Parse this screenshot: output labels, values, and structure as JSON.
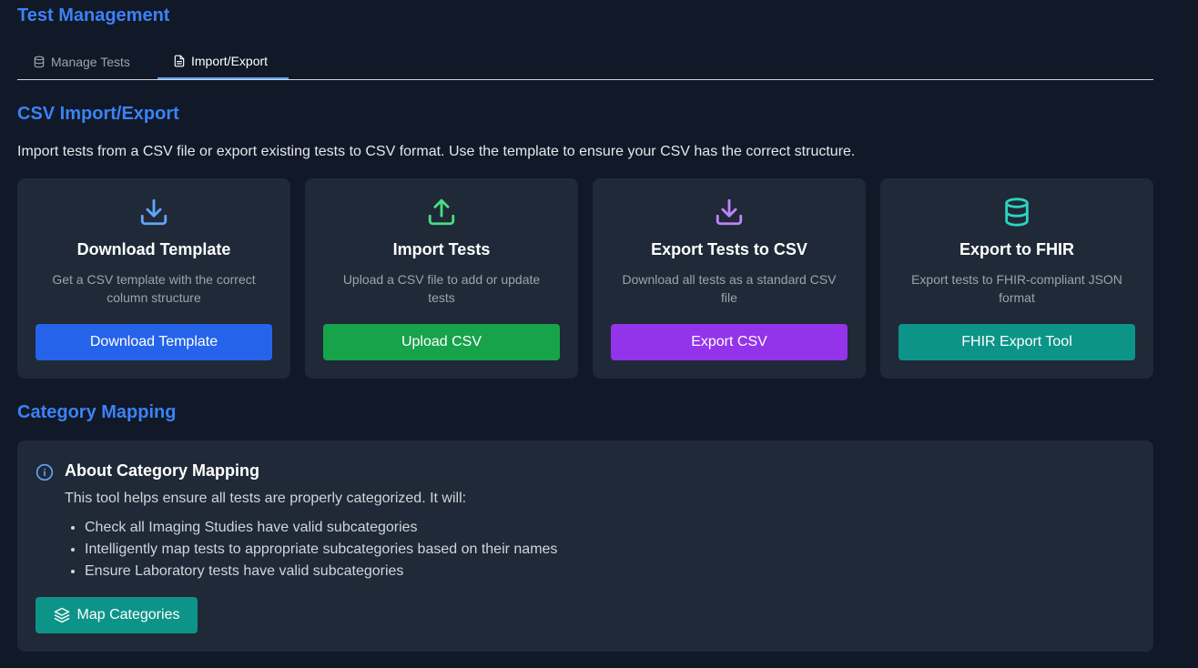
{
  "header": {
    "title": "Test Management"
  },
  "tabs": [
    {
      "label": "Manage Tests",
      "icon": "database-icon",
      "active": false
    },
    {
      "label": "Import/Export",
      "icon": "file-text-icon",
      "active": true
    }
  ],
  "csv_section": {
    "title": "CSV Import/Export",
    "intro": "Import tests from a CSV file or export existing tests to CSV format. Use the template to ensure your CSV has the correct structure.",
    "cards": [
      {
        "icon": "download-icon",
        "icon_color": "#60a5fa",
        "title": "Download Template",
        "description": "Get a CSV template with the correct column structure",
        "button_label": "Download Template",
        "button_color": "#2563eb"
      },
      {
        "icon": "upload-icon",
        "icon_color": "#4ade80",
        "title": "Import Tests",
        "description": "Upload a CSV file to add or update tests",
        "button_label": "Upload CSV",
        "button_color": "#16a34a"
      },
      {
        "icon": "download-icon",
        "icon_color": "#c084fc",
        "title": "Export Tests to CSV",
        "description": "Download all tests as a standard CSV file",
        "button_label": "Export CSV",
        "button_color": "#9333ea"
      },
      {
        "icon": "database-icon",
        "icon_color": "#2dd4bf",
        "title": "Export to FHIR",
        "description": "Export tests to FHIR-compliant JSON format",
        "button_label": "FHIR Export Tool",
        "button_color": "#0d9488"
      }
    ]
  },
  "category_section": {
    "title": "Category Mapping",
    "panel": {
      "icon": "info-icon",
      "title": "About Category Mapping",
      "text": "This tool helps ensure all tests are properly categorized. It will:",
      "items": [
        "Check all Imaging Studies have valid subcategories",
        "Intelligently map tests to appropriate subcategories based on their names",
        "Ensure Laboratory tests have valid subcategories"
      ],
      "button_label": "Map Categories",
      "button_icon": "layers-icon"
    }
  },
  "colors": {
    "accent": "#3b82f6",
    "background": "#111827",
    "card_background": "#1f2937"
  }
}
